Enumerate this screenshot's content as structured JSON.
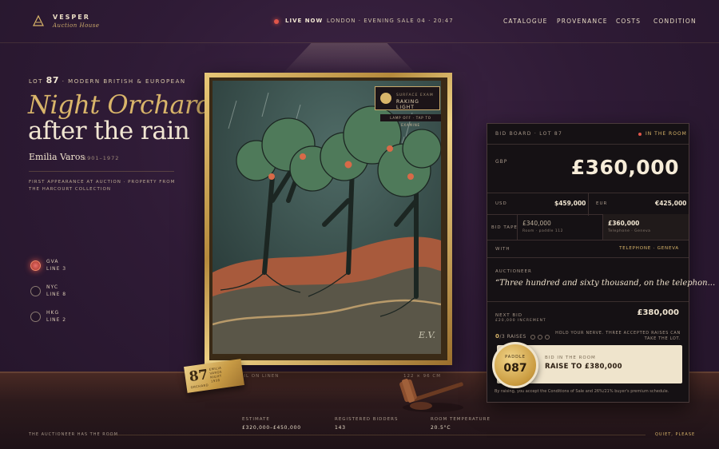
{
  "header": {
    "brand": "VESPER",
    "brand_sub": "Auction House",
    "live": "LIVE NOW",
    "sale": "LONDON · EVENING SALE 04 · 20:47",
    "nav": [
      "CATALOGUE",
      "PROVENANCE",
      "COSTS",
      "CONDITION"
    ]
  },
  "lot": {
    "label": "LOT",
    "number": "87",
    "category": "· MODERN BRITISH & EUROPEAN",
    "title_line1": "Night Orchard,",
    "title_line2": "after the rain",
    "artist": "Emilia Varos",
    "dates": "1901–1972",
    "provenance": "FIRST APPEARANCE AT AUCTION · PROPERTY FROM THE HARCOURT COLLECTION"
  },
  "lines": [
    {
      "city": "GVA",
      "line": "LINE 3",
      "active": true
    },
    {
      "city": "NYC",
      "line": "LINE 8",
      "active": false
    },
    {
      "city": "HKG",
      "line": "LINE 2",
      "active": false
    }
  ],
  "exam": {
    "small": "SURFACE EXAM",
    "big": "RAKING LIGHT",
    "lamp": "LAMP OFF · TAP TO EXAMINE"
  },
  "painting": {
    "monogram": "E.V."
  },
  "board": {
    "title": "BID BOARD · LOT 87",
    "room": "IN THE ROOM",
    "currency": "GBP",
    "amount": "£360,000",
    "usd_label": "USD",
    "usd": "$459,000",
    "eur_label": "EUR",
    "eur": "€425,000",
    "tape_label": "BID TAPE",
    "tape": [
      {
        "amount": "£340,000",
        "sub": "Room · paddle 112"
      },
      {
        "amount": "£360,000",
        "sub": "Telephone · Geneva"
      }
    ],
    "with_label": "WITH",
    "with_value": "TELEPHONE · GENEVA",
    "auctioneer_label": "AUCTIONEER",
    "quote": "“Three hundred and sixty thousand, on the telephon...",
    "next_label": "NEXT BID",
    "next_increment": "£20,000 INCREMENT",
    "next_amount": "£380,000",
    "raises_count": "0",
    "raises_total": "/3 RAISES",
    "hold": "HOLD YOUR NERVE. THREE ACCEPTED RAISES CAN TAKE THE LOT."
  },
  "cta": {
    "paddle_label": "PADDLE",
    "paddle_number": "087",
    "label": "BID IN THE ROOM",
    "button": "RAISE TO £380,000",
    "terms": "By raising, you accept the Conditions of Sale and 26%/21% buyer's premium schedule."
  },
  "plaque": {
    "number": "87",
    "name1": "EMILIA",
    "name2": "VAROS",
    "medium": "NIGHT",
    "year": "1938",
    "bottom": "ORCHARD"
  },
  "plate_left": "OIL ON LINEN",
  "plate_right": "122 × 96 CM",
  "stats": [
    {
      "label": "ESTIMATE",
      "value": "£320,000–£450,000"
    },
    {
      "label": "REGISTERED BIDDERS",
      "value": "143"
    },
    {
      "label": "ROOM TEMPERATURE",
      "value": "20.5°C"
    }
  ],
  "footer": {
    "left": "THE AUCTIONEER HAS THE ROOM",
    "right": "QUIET, PLEASE"
  },
  "colors": {
    "accent": "#d9b56a",
    "live": "#e0564a",
    "background": "#2f1b36"
  }
}
